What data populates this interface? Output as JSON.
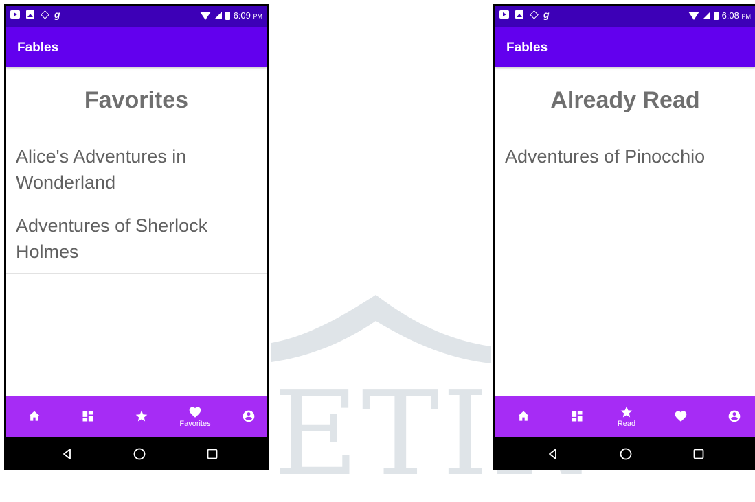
{
  "watermark": {
    "text": "ETIR"
  },
  "screens": [
    {
      "status": {
        "time": "6:09",
        "ampm": "PM"
      },
      "app_title": "Fables",
      "heading": "Favorites",
      "items": [
        "Alice's Adventures in Wonderland",
        "Adventures of Sherlock Holmes"
      ],
      "nav": [
        {
          "icon": "home-icon",
          "label": ""
        },
        {
          "icon": "dashboard-icon",
          "label": ""
        },
        {
          "icon": "star-icon",
          "label": ""
        },
        {
          "icon": "heart-icon",
          "label": "Favorites",
          "active": true
        },
        {
          "icon": "account-icon",
          "label": ""
        }
      ]
    },
    {
      "status": {
        "time": "6:08",
        "ampm": "PM"
      },
      "app_title": "Fables",
      "heading": "Already Read",
      "items": [
        "Adventures of Pinocchio"
      ],
      "nav": [
        {
          "icon": "home-icon",
          "label": ""
        },
        {
          "icon": "dashboard-icon",
          "label": ""
        },
        {
          "icon": "star-icon",
          "label": "Read",
          "active": true
        },
        {
          "icon": "heart-icon",
          "label": ""
        },
        {
          "icon": "account-icon",
          "label": ""
        }
      ]
    }
  ],
  "colors": {
    "status_bar": "#3d00b7",
    "app_bar": "#6200ee",
    "bottom_nav": "#a62cf5",
    "heading_text": "#6f6f6f",
    "item_text": "#616161"
  }
}
